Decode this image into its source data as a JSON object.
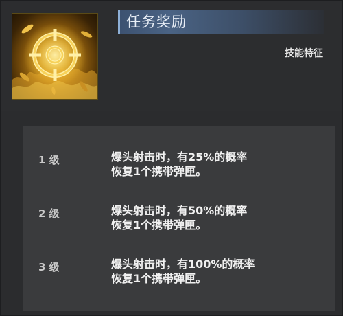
{
  "header": {
    "title": "任务奖励",
    "feature_label": "技能特征",
    "icon": "golden-crosshair-icon"
  },
  "levels": [
    {
      "level": "1 级",
      "line1": "爆头射击时，有25%的概率",
      "line2": "恢复1个携带弹匣。"
    },
    {
      "level": "2 级",
      "line1": "爆头射击时，有50%的概率",
      "line2": "恢复1个携带弹匣。"
    },
    {
      "level": "3 级",
      "line1": "爆头射击时，有100%的概率",
      "line2": "恢复1个携带弹匣。"
    }
  ],
  "colors": {
    "background": "#2b2c2e",
    "levels_panel": "#3a3b3d",
    "title_bar": "#4a6384",
    "icon_gold": "#f2c84a"
  }
}
